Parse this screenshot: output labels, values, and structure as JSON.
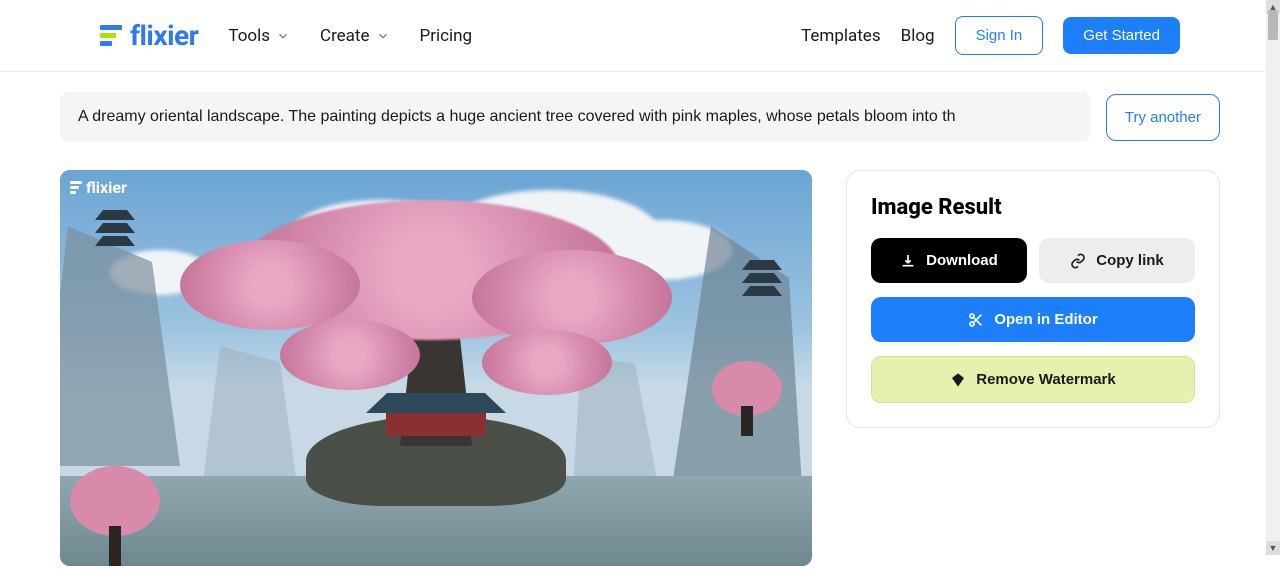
{
  "header": {
    "logo_text": "flixier",
    "nav": {
      "tools": "Tools",
      "create": "Create",
      "pricing": "Pricing",
      "templates": "Templates",
      "blog": "Blog"
    },
    "signin": "Sign In",
    "getstarted": "Get Started"
  },
  "prompt": {
    "value": "A dreamy oriental landscape. The painting depicts a huge ancient tree covered with pink maples, whose petals bloom into th",
    "try_another": "Try another"
  },
  "watermark": "flixier",
  "result": {
    "title": "Image Result",
    "download": "Download",
    "copy_link": "Copy link",
    "open_editor": "Open in Editor",
    "remove_watermark": "Remove Watermark"
  }
}
